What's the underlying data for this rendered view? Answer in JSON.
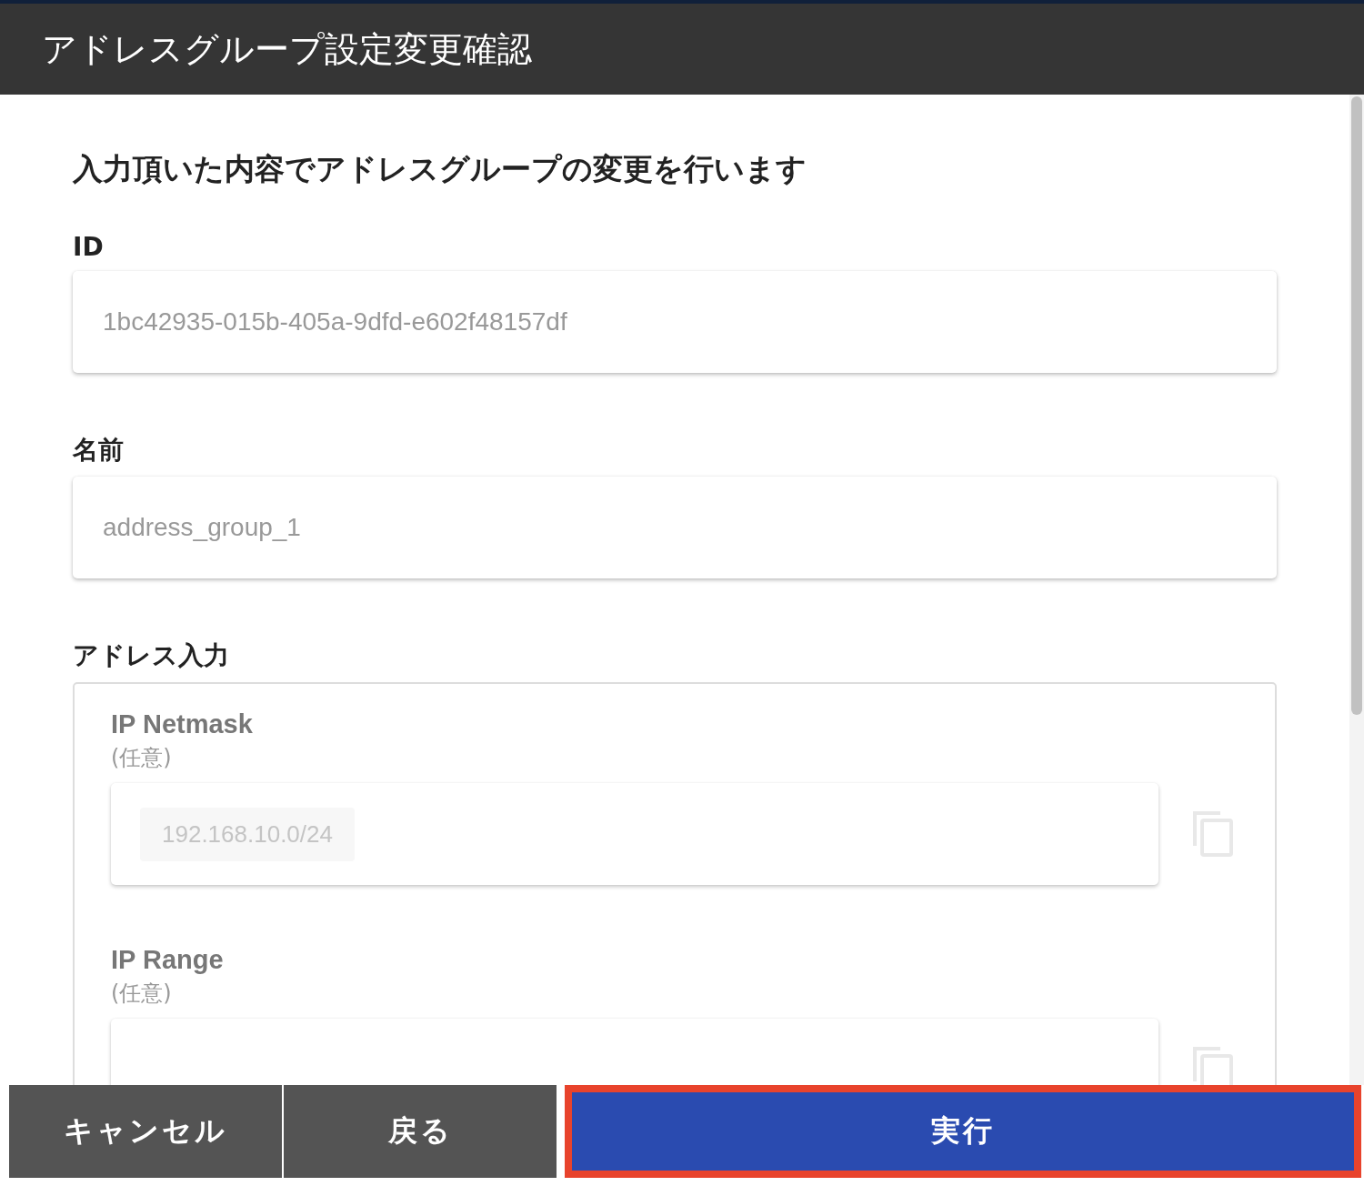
{
  "header": {
    "title": "アドレスグループ設定変更確認"
  },
  "message": "入力頂いた内容でアドレスグループの変更を行います",
  "fields": [
    {
      "label": "ID",
      "value": "1bc42935-015b-405a-9dfd-e602f48157df"
    },
    {
      "label": "名前",
      "value": "address_group_1"
    }
  ],
  "address_section": {
    "label": "アドレス入力",
    "groups": [
      {
        "label": "IP Netmask",
        "note": "(任意)",
        "entries": [
          "192.168.10.0/24"
        ]
      },
      {
        "label": "IP Range",
        "note": "(任意)"
      }
    ]
  },
  "buttons": [
    {
      "label": "キャンセル",
      "kind": "secondary",
      "highlighted": false
    },
    {
      "label": "戻る",
      "kind": "secondary",
      "highlighted": false
    },
    {
      "label": "実行",
      "kind": "primary",
      "highlighted": true
    }
  ]
}
